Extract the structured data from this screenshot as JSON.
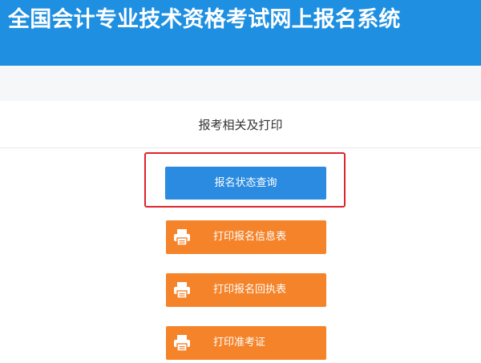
{
  "header": {
    "title": "全国会计专业技术资格考试网上报名系统",
    "background_color": "#1e8fe1"
  },
  "section": {
    "title": "报考相关及打印"
  },
  "buttons": {
    "status_query": {
      "label": "报名状态查询",
      "color": "#2b8be0",
      "highlighted": true,
      "highlight_color": "#e0232c"
    },
    "print_info": {
      "label": "打印报名信息表",
      "icon": "printer-icon",
      "color": "#f4832a"
    },
    "print_receipt": {
      "label": "打印报名回执表",
      "icon": "printer-icon",
      "color": "#f4832a"
    },
    "print_admission": {
      "label": "打印准考证",
      "icon": "printer-icon",
      "color": "#f4832a"
    }
  }
}
